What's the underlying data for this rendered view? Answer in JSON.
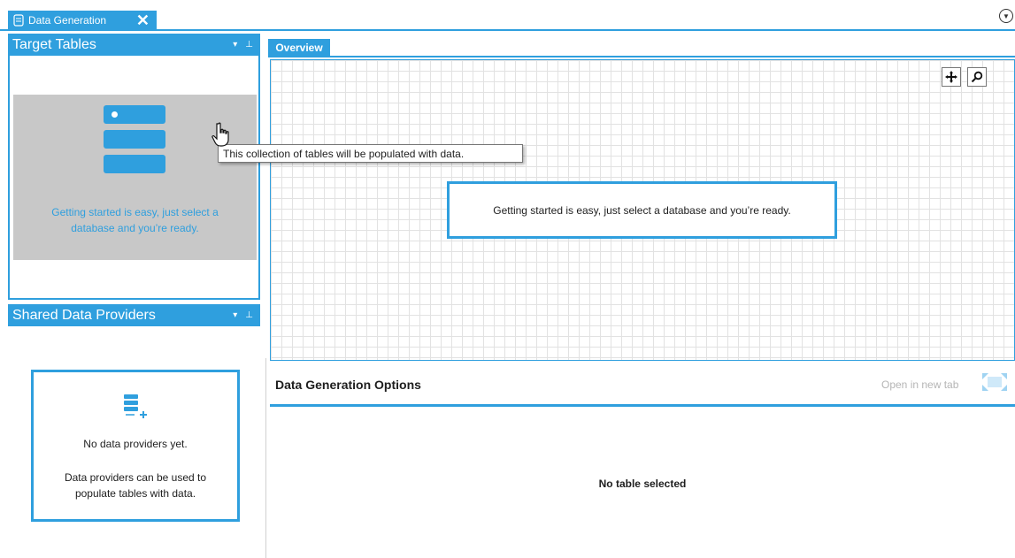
{
  "document_tab": {
    "label": "Data Generation",
    "close": "✕"
  },
  "target_tables": {
    "title": "Target Tables",
    "empty_text": "Getting started is easy, just select a database and you’re ready.",
    "tooltip": "This collection of tables will be populated with data."
  },
  "shared_providers": {
    "title": "Shared Data Providers",
    "empty_title": "No data providers yet.",
    "empty_text_1": "Data providers can be used to",
    "empty_text_2": "populate tables with data."
  },
  "overview": {
    "tab_label": "Overview",
    "empty_text": "Getting started is easy, just select a database and you’re ready."
  },
  "data_generation_options": {
    "title": "Data Generation Options",
    "open_new_tab": "Open in new tab",
    "no_selection": "No table selected"
  },
  "colors": {
    "accent": "#2f9fde",
    "gray_panel": "#c8c8c8",
    "tooltip_border": "#767676"
  },
  "icons": [
    "database-doc-icon",
    "close-icon",
    "overflow-menu-icon",
    "pin-icon",
    "dropdown-icon",
    "database-icon",
    "hand-cursor-icon",
    "add-provider-icon",
    "pan-icon",
    "zoom-icon",
    "open-new-tab-icon"
  ]
}
